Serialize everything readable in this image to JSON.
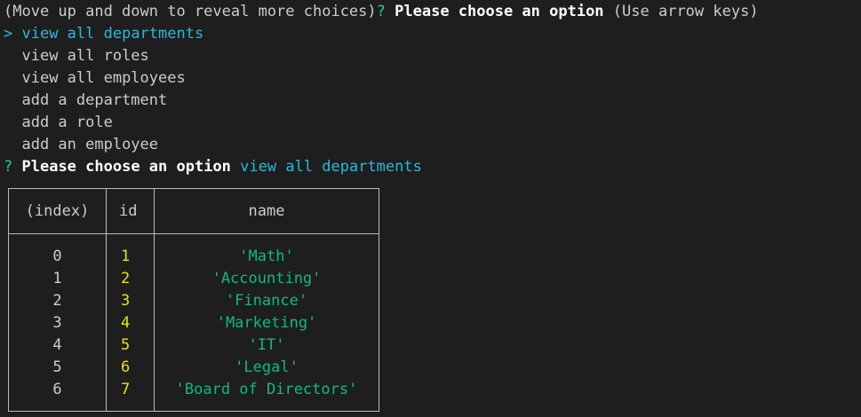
{
  "prompt_header": {
    "hint": "(Move up and down to reveal more choices)",
    "q_mark": "?",
    "question": "Please choose an option",
    "keys_hint": "(Use arrow keys)"
  },
  "menu": {
    "pointer": ">",
    "items": [
      "view all departments",
      "view all roles",
      "view all employees",
      "add a department",
      "add a role",
      "add an employee"
    ]
  },
  "answer": {
    "q_mark": "?",
    "question": "Please choose an option",
    "value": "view all departments"
  },
  "table": {
    "headers": [
      "(index)",
      "id",
      "name"
    ],
    "rows": [
      {
        "index": "0",
        "id": "1",
        "name": "'Math'"
      },
      {
        "index": "1",
        "id": "2",
        "name": "'Accounting'"
      },
      {
        "index": "2",
        "id": "3",
        "name": "'Finance'"
      },
      {
        "index": "3",
        "id": "4",
        "name": "'Marketing'"
      },
      {
        "index": "4",
        "id": "5",
        "name": "'IT'"
      },
      {
        "index": "5",
        "id": "6",
        "name": "'Legal'"
      },
      {
        "index": "6",
        "id": "7",
        "name": "'Board of Directors'"
      }
    ]
  },
  "colors": {
    "background": "#1e1e1e",
    "text": "#cccccc",
    "prompt_green": "#23d18b",
    "selected_cyan": "#29b8db",
    "number_yellow": "#e5e510",
    "string_green": "#0dbc79"
  }
}
